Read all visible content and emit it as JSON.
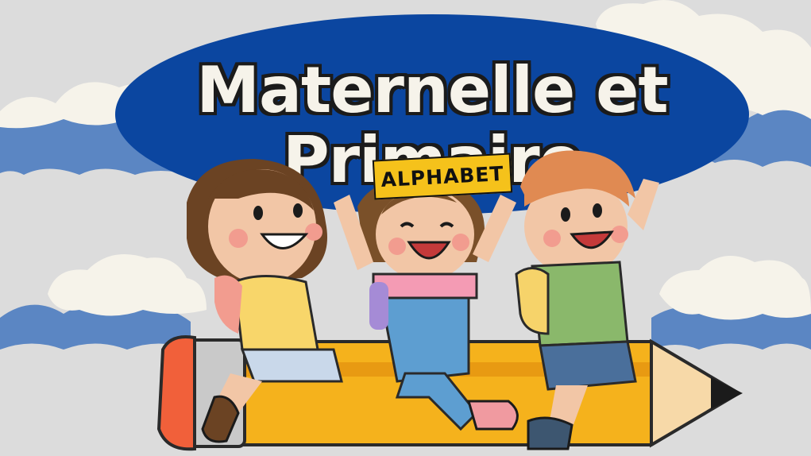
{
  "title": "Maternelle et Primaire",
  "tag": "ALPHABET",
  "colors": {
    "background": "#dcdcdc",
    "oval": "#0b46a0",
    "title_text": "#f6f3ea",
    "tag_bg": "#f5c21b",
    "clouds": "#f6f3ea",
    "cloud_shadow": "#5b86c3",
    "pencil": "#f5b21c"
  },
  "illustration": {
    "subjects": [
      "girl-brown-hair-icon",
      "girl-overalls-icon",
      "boy-orange-hair-icon",
      "pencil-icon"
    ]
  }
}
